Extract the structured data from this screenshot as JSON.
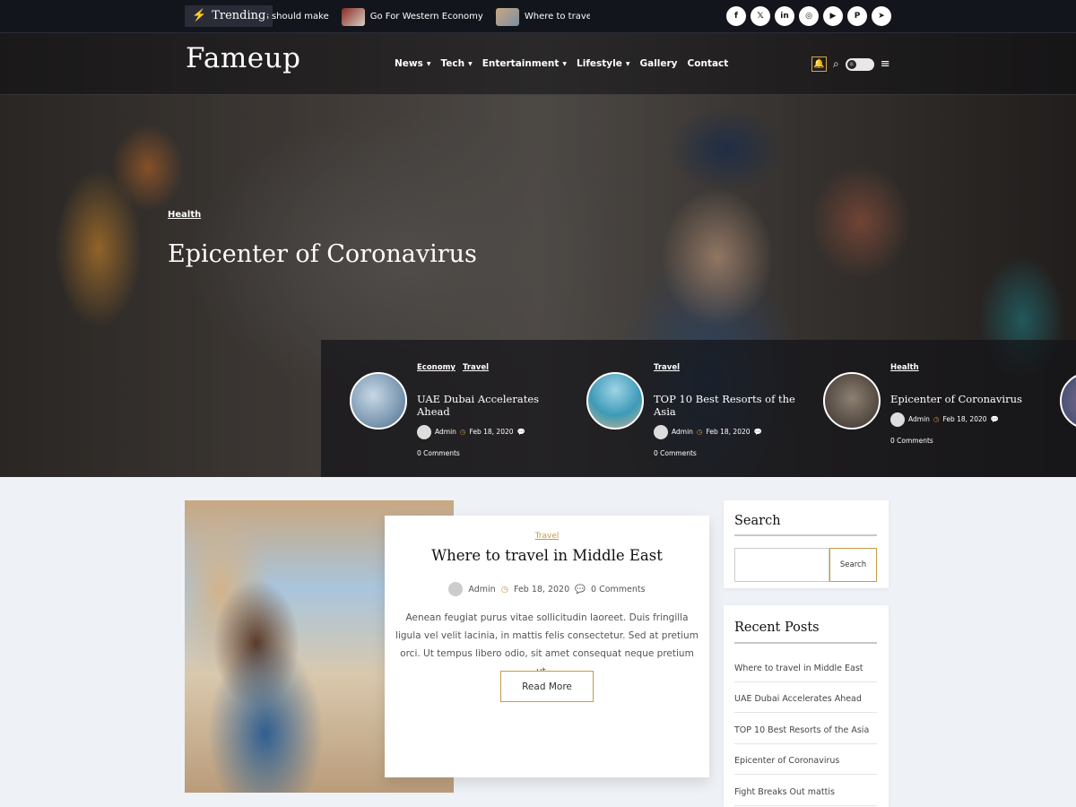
{
  "topbar": {
    "trending_label": "Trending",
    "ticker": [
      {
        "text": "ty's should make"
      },
      {
        "text": "Go For Western Economy"
      },
      {
        "text": "Where to trave"
      }
    ],
    "socials": [
      "facebook-icon",
      "x-icon",
      "linkedin-icon",
      "instagram-icon",
      "youtube-icon",
      "pinterest-icon",
      "telegram-icon"
    ]
  },
  "header": {
    "logo": "Fameup",
    "nav": [
      {
        "label": "News",
        "dropdown": true
      },
      {
        "label": "Tech",
        "dropdown": true
      },
      {
        "label": "Entertainment",
        "dropdown": true
      },
      {
        "label": "Lifestyle",
        "dropdown": true
      },
      {
        "label": "Gallery",
        "dropdown": false
      },
      {
        "label": "Contact",
        "dropdown": false
      }
    ]
  },
  "hero": {
    "category": "Health",
    "title": "Epicenter of Coronavirus"
  },
  "slider": [
    {
      "cats": [
        "Economy",
        "Travel"
      ],
      "title": "UAE Dubai Accelerates Ahead",
      "author": "Admin",
      "date": "Feb 18, 2020",
      "comments": "0 Comments"
    },
    {
      "cats": [
        "Travel"
      ],
      "title": "TOP 10 Best Resorts of the Asia",
      "author": "Admin",
      "date": "Feb 18, 2020",
      "comments": "0 Comments"
    },
    {
      "cats": [
        "Health"
      ],
      "title": "Epicenter of Coronavirus",
      "author": "Admin",
      "date": "Feb 18, 2020",
      "comments": "0 Comments"
    }
  ],
  "post": {
    "category": "Travel",
    "title": "Where to travel in Middle East",
    "author": "Admin",
    "date": "Feb 18, 2020",
    "comments": "0 Comments",
    "excerpt": "Aenean feugiat purus vitae sollicitudin laoreet. Duis fringilla ligula vel velit lacinia, in mattis felis consectetur. Sed at pretium orci. Ut tempus libero odio, sit amet consequat neque pretium ut....",
    "read_more": "Read More"
  },
  "sidebar": {
    "search_title": "Search",
    "search_button": "Search",
    "search_value": "",
    "recent_title": "Recent Posts",
    "recent_posts": [
      "Where to travel in Middle East",
      "UAE Dubai Accelerates Ahead",
      "TOP 10 Best Resorts of the Asia",
      "Epicenter of Coronavirus",
      "Fight Breaks Out mattis"
    ]
  },
  "colors": {
    "accent": "#c89b47",
    "dark": "#13151c"
  }
}
